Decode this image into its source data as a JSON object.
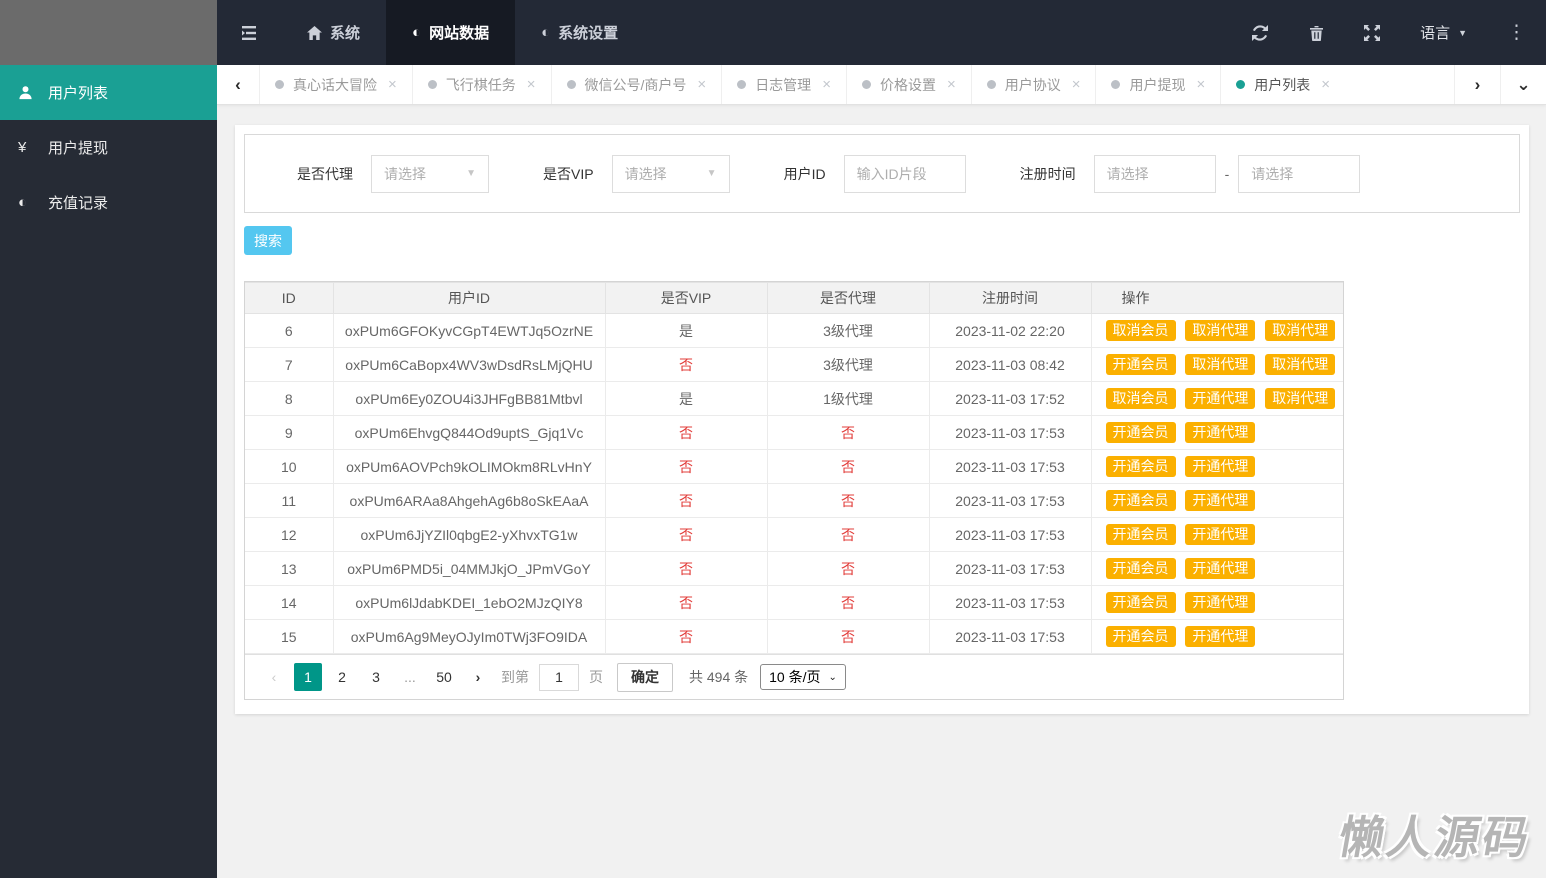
{
  "colors": {
    "teal": "#1aa094",
    "pager_active": "#009688",
    "amber": "#fbb000",
    "blue": "#54c7f0",
    "red": "#e23c39",
    "navbar_bg": "#232936",
    "sidebar_bg": "#262b35"
  },
  "icons": {
    "yen": "¥",
    "half_circle": "◐",
    "close": "×",
    "caret_down": "▼",
    "caret_small": "⌄",
    "chevron_left": "‹",
    "chevron_right": "›",
    "kebab": "⋮"
  },
  "navbar": {
    "menu": [
      {
        "label": "系统"
      },
      {
        "label": "网站数据"
      },
      {
        "label": "系统设置"
      }
    ],
    "language_label": "语言"
  },
  "sidebar": {
    "items": [
      {
        "label": "用户列表"
      },
      {
        "label": "用户提现"
      },
      {
        "label": "充值记录"
      }
    ]
  },
  "tabbar": {
    "tabs": [
      {
        "label": "真心话大冒险"
      },
      {
        "label": "飞行棋任务"
      },
      {
        "label": "微信公号/商户号"
      },
      {
        "label": "日志管理"
      },
      {
        "label": "价格设置"
      },
      {
        "label": "用户协议"
      },
      {
        "label": "用户提现"
      },
      {
        "label": "用户列表"
      }
    ]
  },
  "filters": {
    "agent": {
      "label": "是否代理",
      "placeholder": "请选择"
    },
    "vip": {
      "label": "是否VIP",
      "placeholder": "请选择"
    },
    "user_id": {
      "label": "用户ID",
      "placeholder": "输入ID片段"
    },
    "reg_time": {
      "label": "注册时间",
      "start_placeholder": "请选择",
      "end_placeholder": "请选择",
      "separator": "-"
    }
  },
  "search_button": "搜索",
  "table": {
    "headers": [
      "ID",
      "用户ID",
      "是否VIP",
      "是否代理",
      "注册时间",
      "操作"
    ],
    "rows": [
      {
        "id": "6",
        "user_id": "oxPUm6GFOKyvCGpT4EWTJq5OzrNE",
        "vip": "是",
        "agent": "3级代理",
        "time": "2023-11-02 22:20",
        "actions": [
          "取消会员",
          "取消代理",
          "取消代理"
        ]
      },
      {
        "id": "7",
        "user_id": "oxPUm6CaBopx4WV3wDsdRsLMjQHU",
        "vip": "否",
        "agent": "3级代理",
        "time": "2023-11-03 08:42",
        "actions": [
          "开通会员",
          "取消代理",
          "取消代理"
        ]
      },
      {
        "id": "8",
        "user_id": "oxPUm6Ey0ZOU4i3JHFgBB81Mtbvl",
        "vip": "是",
        "agent": "1级代理",
        "time": "2023-11-03 17:52",
        "actions": [
          "取消会员",
          "开通代理",
          "取消代理"
        ]
      },
      {
        "id": "9",
        "user_id": "oxPUm6EhvgQ844Od9uptS_Gjq1Vc",
        "vip": "否",
        "agent": "否",
        "time": "2023-11-03 17:53",
        "actions": [
          "开通会员",
          "开通代理"
        ]
      },
      {
        "id": "10",
        "user_id": "oxPUm6AOVPch9kOLIMOkm8RLvHnY",
        "vip": "否",
        "agent": "否",
        "time": "2023-11-03 17:53",
        "actions": [
          "开通会员",
          "开通代理"
        ]
      },
      {
        "id": "11",
        "user_id": "oxPUm6ARAa8AhgehAg6b8oSkEAaA",
        "vip": "否",
        "agent": "否",
        "time": "2023-11-03 17:53",
        "actions": [
          "开通会员",
          "开通代理"
        ]
      },
      {
        "id": "12",
        "user_id": "oxPUm6JjYZIl0qbgE2-yXhvxTG1w",
        "vip": "否",
        "agent": "否",
        "time": "2023-11-03 17:53",
        "actions": [
          "开通会员",
          "开通代理"
        ]
      },
      {
        "id": "13",
        "user_id": "oxPUm6PMD5i_04MMJkjO_JPmVGoY",
        "vip": "否",
        "agent": "否",
        "time": "2023-11-03 17:53",
        "actions": [
          "开通会员",
          "开通代理"
        ]
      },
      {
        "id": "14",
        "user_id": "oxPUm6lJdabKDEI_1ebO2MJzQIY8",
        "vip": "否",
        "agent": "否",
        "time": "2023-11-03 17:53",
        "actions": [
          "开通会员",
          "开通代理"
        ]
      },
      {
        "id": "15",
        "user_id": "oxPUm6Ag9MeyOJyIm0TWj3FO9IDA",
        "vip": "否",
        "agent": "否",
        "time": "2023-11-03 17:53",
        "actions": [
          "开通会员",
          "开通代理"
        ]
      }
    ]
  },
  "pagination": {
    "pages": [
      "1",
      "2",
      "3",
      "...",
      "50"
    ],
    "goto_label": "到第",
    "goto_value": "1",
    "page_label": "页",
    "confirm_label": "确定",
    "total": "共 494 条",
    "page_size": "10 条/页"
  },
  "watermark": "懒人源码"
}
